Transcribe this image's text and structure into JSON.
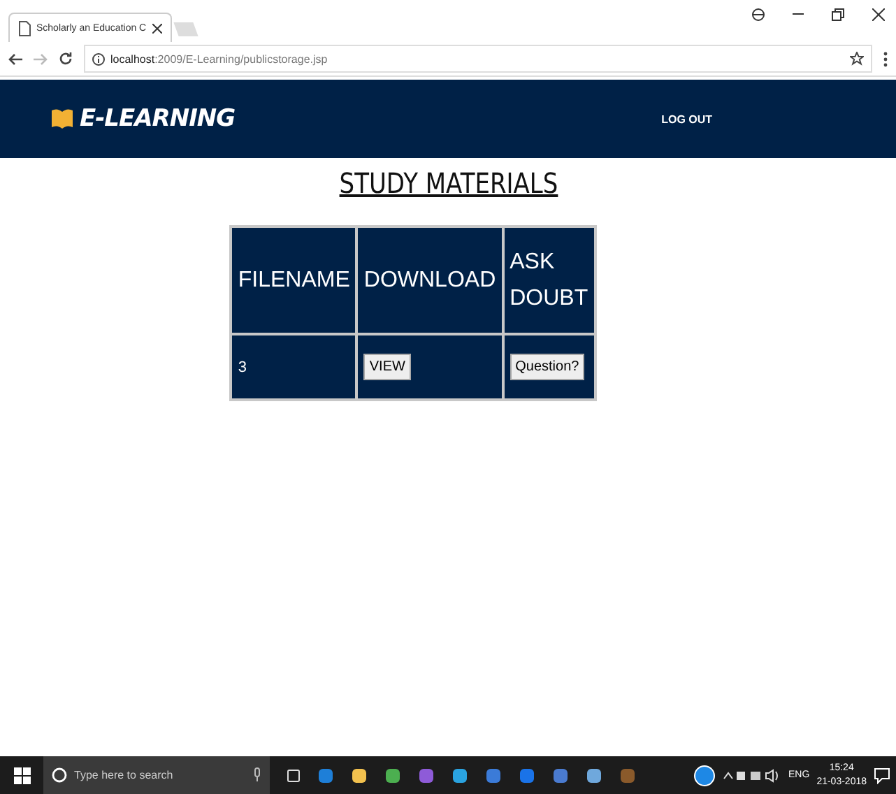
{
  "browser": {
    "tab_title": "Scholarly an Education C",
    "url_host": "localhost",
    "url_path": ":2009/E-Learning/publicstorage.jsp"
  },
  "navbar": {
    "brand": "E-LEARNING",
    "links": [
      "LOG OUT"
    ]
  },
  "page_title": "STUDY MATERIALS",
  "table": {
    "columns": [
      "FILENAME",
      "DOWNLOAD",
      "ASK DOUBT"
    ],
    "rows": [
      {
        "filename": "3",
        "download": "VIEW",
        "ask": "Question?"
      }
    ]
  },
  "taskbar": {
    "search_placeholder": "Type here to search",
    "language": "ENG",
    "time": "15:24",
    "date": "21-03-2018"
  }
}
